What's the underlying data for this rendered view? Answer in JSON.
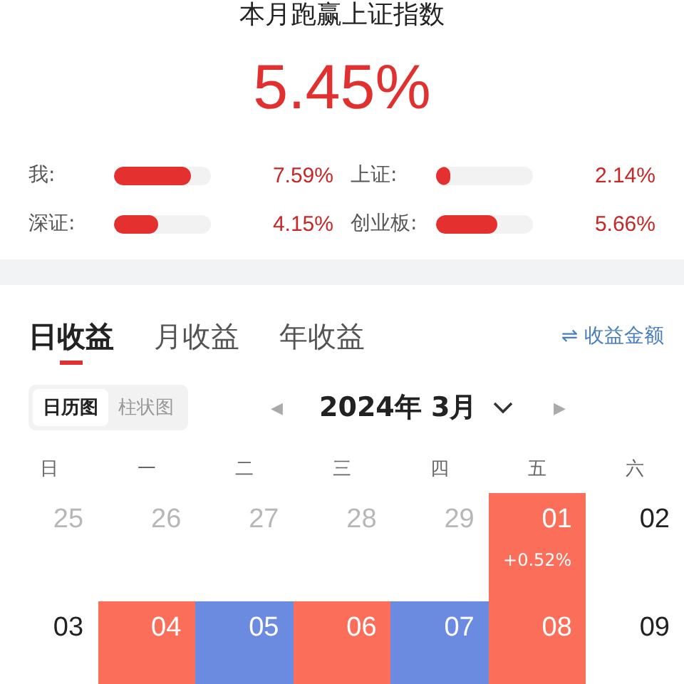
{
  "header": {
    "title": "本月跑赢上证指数",
    "value": "5.45%"
  },
  "comparisons": [
    {
      "label": "我:",
      "level": 0.8,
      "reading": "7.59%"
    },
    {
      "label": "上证:",
      "level": 0.15,
      "reading": "2.14%"
    },
    {
      "label": "深证:",
      "level": 0.45,
      "reading": "4.15%"
    },
    {
      "label": "创业板:",
      "level": 0.63,
      "reading": "5.66%"
    }
  ],
  "tabs": [
    {
      "label": "日收益",
      "selected": true
    },
    {
      "label": "月收益",
      "selected": false
    },
    {
      "label": "年收益",
      "selected": false
    }
  ],
  "switch_button": {
    "icon": "⇌",
    "label": "收益金额"
  },
  "view_toggle": [
    {
      "label": "日历图",
      "selected": true
    },
    {
      "label": "柱状图",
      "selected": false
    }
  ],
  "month_picker": {
    "prev": "◀",
    "label": "2024年 3月",
    "next": "▶"
  },
  "calendar": {
    "weekdays": [
      "日",
      "一",
      "二",
      "三",
      "四",
      "五",
      "六"
    ],
    "weeks": [
      [
        {
          "day": "25",
          "muted": true
        },
        {
          "day": "26",
          "muted": true
        },
        {
          "day": "27",
          "muted": true
        },
        {
          "day": "28",
          "muted": true
        },
        {
          "day": "29",
          "muted": true
        },
        {
          "day": "01",
          "muted": false,
          "color": "#fa6e5a",
          "change": "+0.52%"
        },
        {
          "day": "02",
          "muted": false
        }
      ],
      [
        {
          "day": "03",
          "muted": false
        },
        {
          "day": "04",
          "muted": false,
          "color": "#fa6e5a"
        },
        {
          "day": "05",
          "muted": false,
          "color": "#6b8be0"
        },
        {
          "day": "06",
          "muted": false,
          "color": "#fa6e5a"
        },
        {
          "day": "07",
          "muted": false,
          "color": "#6b8be0"
        },
        {
          "day": "08",
          "muted": false,
          "color": "#fa6e5a"
        },
        {
          "day": "09",
          "muted": false
        }
      ]
    ]
  }
}
